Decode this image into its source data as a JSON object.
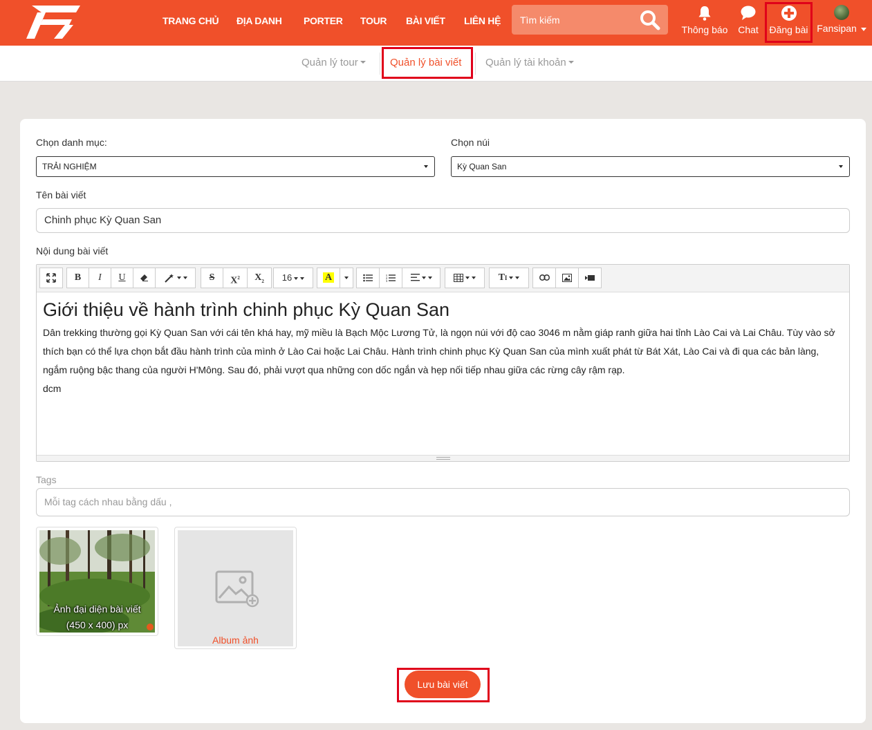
{
  "nav": {
    "links": [
      "TRANG CHỦ",
      "ĐỊA DANH",
      "PORTER",
      "TOUR",
      "BÀI VIẾT",
      "LIÊN HỆ"
    ],
    "search_placeholder": "Tìm kiếm",
    "notifications_label": "Thông báo",
    "chat_label": "Chat",
    "post_label": "Đăng bài",
    "user_name": "Fansipan"
  },
  "subnav": {
    "tour_manage": "Quản lý tour",
    "post_manage": "Quản lý bài viết",
    "account_manage": "Quản lý tài khoản"
  },
  "form": {
    "category_label": "Chọn danh mục:",
    "category_value": "TRẢI NGHIỆM",
    "mountain_label": "Chọn núi",
    "mountain_value": "Kỳ Quan San",
    "title_label": "Tên bài viết",
    "title_value": "Chinh phục Kỳ Quan San",
    "content_label": "Nội dung bài viết",
    "tags_label": "Tags",
    "tags_placeholder": "Mỗi tag cách nhau bằng dấu ,"
  },
  "editor": {
    "font_size": "16",
    "heading": "Giới thiệu về hành trình chinh phục Kỳ Quan San",
    "paragraph": "Dân trekking thường gọi Kỳ Quan San với cái tên khá hay, mỹ miều là Bạch Mộc Lương Tử, là ngọn núi với độ cao 3046 m nằm giáp ranh giữa hai tỉnh Lào Cai và Lai Châu. Tùy vào sở thích bạn có thể lựa chọn bắt đầu hành trình của mình ở Lào Cai hoặc Lai Châu. Hành trình chinh phục Kỳ Quan San của mình xuất phát từ Bát Xát, Lào Cai  và đi qua các bản làng, ngắm ruộng bậc thang của người H'Mông. Sau đó, phải vượt qua những con dốc ngắn và hẹp nối tiếp nhau giữa các rừng cây rậm rạp.",
    "extra_line": "dcm"
  },
  "images": {
    "cover_caption_1": "Ảnh đại diện bài viết",
    "cover_caption_2": "(450 x 400) px",
    "album_caption": "Album ảnh"
  },
  "save_button": "Lưu bài viết",
  "colors": {
    "brand": "#f0502a",
    "highlight": "#e0001a"
  }
}
